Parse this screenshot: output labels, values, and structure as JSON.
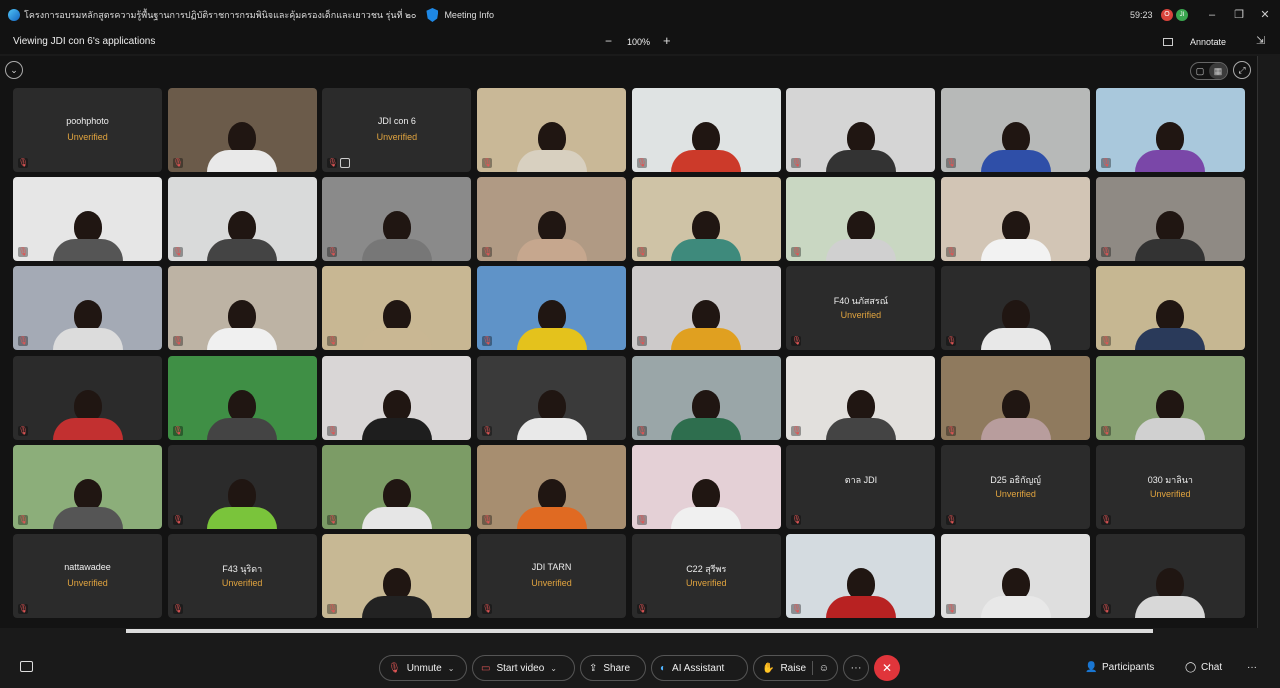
{
  "titlebar": {
    "meeting_title": "โครงการอบรมหลักสูตรความรู้พื้นฐานการปฏิบัติราชการกรมพินิจและคุ้มครองเด็กและเยาวชน รุ่นที่ ๒๐",
    "meeting_info": "Meeting Info",
    "timer": "59:23",
    "badge1": "O",
    "badge2": "JI"
  },
  "sharebar": {
    "viewing": "Viewing JDI con 6's applications",
    "zoom": "100%",
    "annotate": "Annotate"
  },
  "tiles": [
    {
      "name": "poohphoto",
      "unverified": "Unverified",
      "bg": "#2b2b2b"
    },
    {
      "name": "",
      "bg": "#6b5b4a",
      "shirt": "#e9e9e9"
    },
    {
      "name": "JDI con 6",
      "unverified": "Unverified",
      "bg": "#2b2b2b"
    },
    {
      "name": "",
      "bg": "#c9b897",
      "shirt": "#d8d0c0"
    },
    {
      "name": "",
      "bg": "#dfe3e3",
      "shirt": "#cc3a2a"
    },
    {
      "name": "",
      "bg": "#d5d5d5",
      "shirt": "#333"
    },
    {
      "name": "",
      "bg": "#b7b9b8",
      "shirt": "#2f4fa8"
    },
    {
      "name": "",
      "bg": "#a9c8dc",
      "shirt": "#7a47a8"
    },
    {
      "name": "",
      "bg": "#e6e6e6",
      "shirt": "#555"
    },
    {
      "name": "",
      "bg": "#d9dada",
      "shirt": "#444"
    },
    {
      "name": "",
      "bg": "#8a8a8a",
      "shirt": "#777"
    },
    {
      "name": "",
      "bg": "#b09a84",
      "shirt": "#c6a78e"
    },
    {
      "name": "",
      "bg": "#cfc3a6",
      "shirt": "#3e8a7c"
    },
    {
      "name": "",
      "bg": "#c9d7c2",
      "shirt": "#d0d0d0"
    },
    {
      "name": "",
      "bg": "#d2c5b5",
      "shirt": "#f2f2f2"
    },
    {
      "name": "",
      "bg": "#8f8a84",
      "shirt": "#333"
    },
    {
      "name": "",
      "bg": "#a4aab5",
      "shirt": "#dcdcdc"
    },
    {
      "name": "",
      "bg": "#bdb3a4",
      "shirt": "#f0f0f0"
    },
    {
      "name": "",
      "bg": "#c8b793",
      "shirt": "#c9b793"
    },
    {
      "name": "",
      "bg": "#5f93c8",
      "shirt": "#e4c21c"
    },
    {
      "name": "",
      "bg": "#cdcaca",
      "shirt": "#e0a020"
    },
    {
      "name": "F40 นภัสสรณ์",
      "unverified": "Unverified",
      "bg": "#2b2b2b"
    },
    {
      "name": "",
      "bg": "#2b2b2b",
      "shirt": "#e8e8e8"
    },
    {
      "name": "",
      "bg": "#c6b792",
      "shirt": "#2a3a5a"
    },
    {
      "name": "",
      "bg": "#2b2b2b",
      "shirt": "#c23030"
    },
    {
      "name": "",
      "bg": "#3f8f45",
      "shirt": "#444"
    },
    {
      "name": "",
      "bg": "#d9d6d6",
      "shirt": "#1e1e1e"
    },
    {
      "name": "",
      "bg": "#3a3a3a",
      "shirt": "#e9e9e9"
    },
    {
      "name": "",
      "bg": "#9aa6a8",
      "shirt": "#2e6e4e"
    },
    {
      "name": "",
      "bg": "#e2e0dd",
      "shirt": "#444"
    },
    {
      "name": "",
      "bg": "#8f7a5e",
      "shirt": "#b89d9d"
    },
    {
      "name": "",
      "bg": "#87a072",
      "shirt": "#d0d0d0"
    },
    {
      "name": "",
      "bg": "#8cae7a",
      "shirt": "#555"
    },
    {
      "name": "",
      "bg": "#2b2b2b",
      "shirt": "#7ac43b"
    },
    {
      "name": "",
      "bg": "#7c9c66",
      "shirt": "#e6e6e6"
    },
    {
      "name": "",
      "bg": "#a78e70",
      "shirt": "#e06a22"
    },
    {
      "name": "",
      "bg": "#e4d0d6",
      "shirt": "#f0f0f0"
    },
    {
      "name": "ตาล JDI",
      "bg": "#2b2b2b"
    },
    {
      "name": "D25 อธิกัญญ์",
      "unverified": "Unverified",
      "bg": "#2b2b2b"
    },
    {
      "name": "030 มาลินา",
      "unverified": "Unverified",
      "bg": "#2b2b2b"
    },
    {
      "name": "nattawadee",
      "unverified": "Unverified",
      "bg": "#2b2b2b"
    },
    {
      "name": "F43 นุริดา",
      "unverified": "Unverified",
      "bg": "#2b2b2b"
    },
    {
      "name": "",
      "bg": "#c7b894",
      "shirt": "#222"
    },
    {
      "name": "JDI TARN",
      "unverified": "Unverified",
      "bg": "#2b2b2b"
    },
    {
      "name": "C22 สุรีพร",
      "unverified": "Unverified",
      "bg": "#2b2b2b"
    },
    {
      "name": "",
      "bg": "#d4dbe0",
      "shirt": "#b82222"
    },
    {
      "name": "",
      "bg": "#dedede",
      "shirt": "#e8e8e8"
    },
    {
      "name": "",
      "bg": "#2b2b2b",
      "shirt": "#d8d8d8"
    }
  ],
  "controls": {
    "unmute": "Unmute",
    "start_video": "Start video",
    "share": "Share",
    "ai_assistant": "AI Assistant",
    "raise": "Raise",
    "participants": "Participants",
    "chat": "Chat"
  }
}
